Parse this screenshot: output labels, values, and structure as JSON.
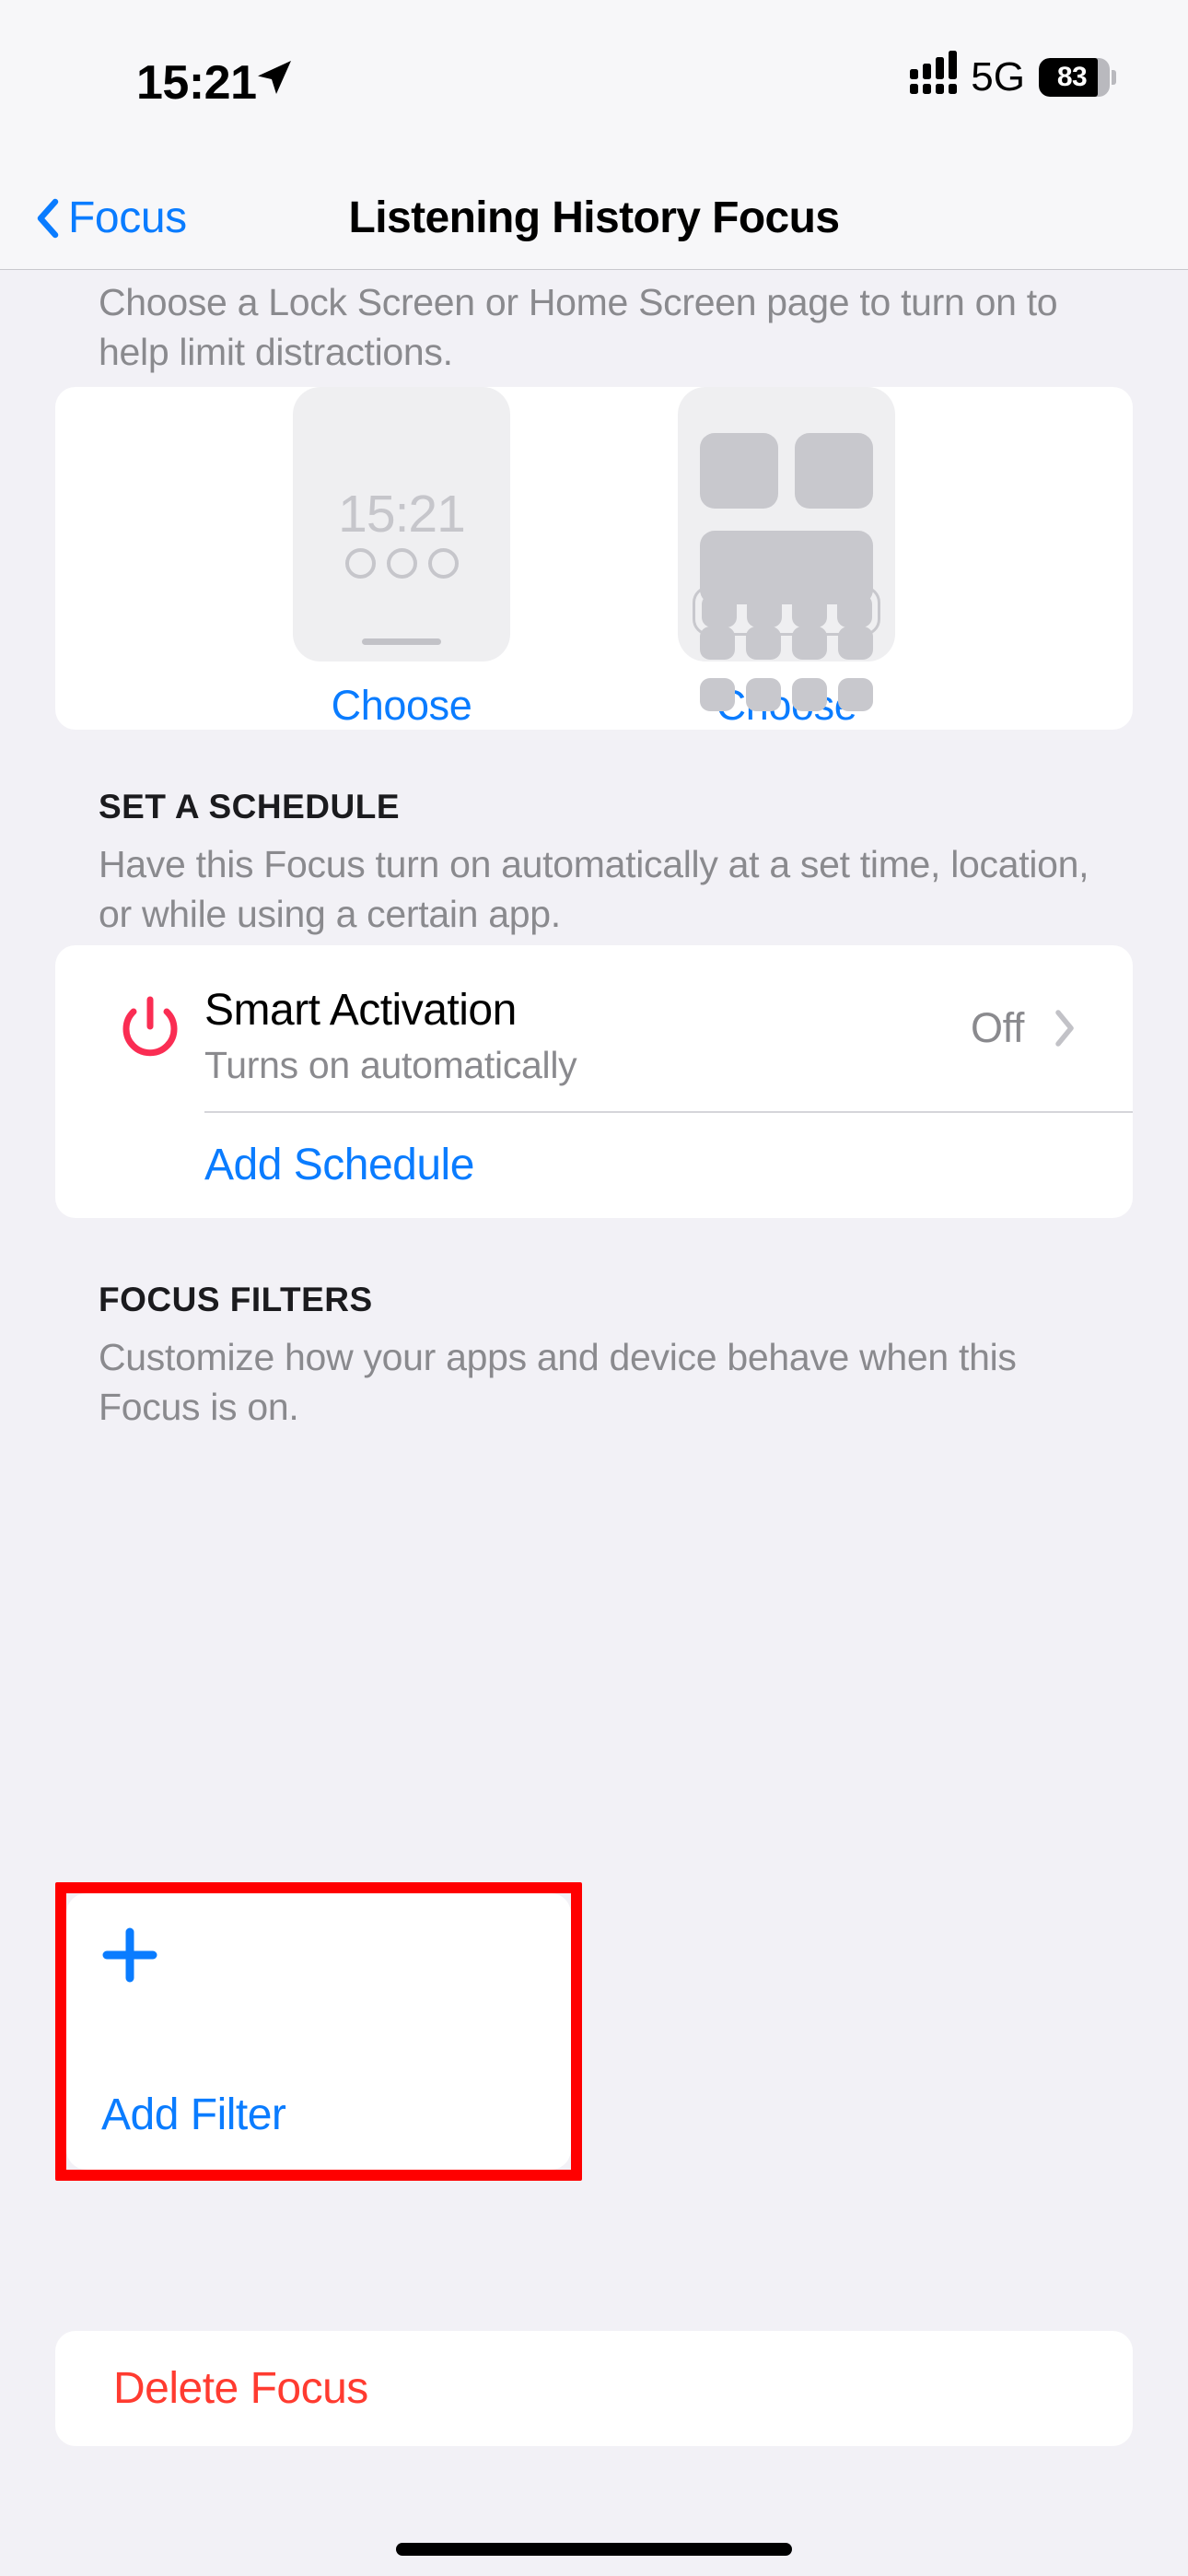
{
  "status_bar": {
    "time": "15:21",
    "location_icon": "location-arrow-icon",
    "signal_icon": "cellular-signal-icon",
    "network": "5G",
    "battery_percent": "83",
    "battery_level": 83
  },
  "nav": {
    "back_label": "Focus",
    "back_icon": "chevron-left-icon",
    "title": "Listening History Focus"
  },
  "screen_page": {
    "description": "Choose a Lock Screen or Home Screen page to turn on to help limit distractions.",
    "lock_preview": {
      "time": "15:21",
      "dots": 3
    },
    "home_preview": {
      "top_widgets": 2,
      "wide_widgets": 1,
      "icon_rows": 2,
      "icons_per_row": 4,
      "dock_icons": 4
    },
    "lock_choose_label": "Choose",
    "home_choose_label": "Choose"
  },
  "schedule": {
    "header": "SET A SCHEDULE",
    "description": "Have this Focus turn on automatically at a set time, location, or while using a certain app.",
    "smart_activation": {
      "icon": "power-icon",
      "icon_color": "#FA2D53",
      "title": "Smart Activation",
      "subtitle": "Turns on automatically",
      "value": "Off",
      "chevron": "chevron-right-icon"
    },
    "add_schedule_label": "Add Schedule"
  },
  "focus_filters": {
    "header": "FOCUS FILTERS",
    "description": "Customize how your apps and device behave when this Focus is on.",
    "add_filter": {
      "icon": "plus-icon",
      "label": "Add Filter"
    },
    "highlight_color": "#FF0000"
  },
  "delete": {
    "label": "Delete Focus",
    "color": "#FF3B30"
  },
  "colors": {
    "background": "#F2F1F6",
    "card": "#FFFFFF",
    "accent_blue": "#0A7CFF",
    "destructive_red": "#FF3B30",
    "secondary_text": "#8A8A8E"
  }
}
